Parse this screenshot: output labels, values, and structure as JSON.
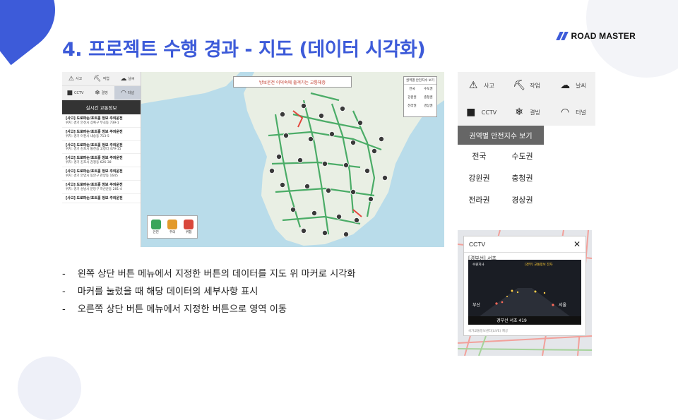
{
  "slide": {
    "title": "4. 프로젝트 수행 경과 - 지도 (데이터 시각화)",
    "logo_text": "ROAD MASTER",
    "bullets": [
      "왼쪽 상단 버튼 메뉴에서 지정한 버튼의 데이터를 지도 위 마커로 시각화",
      "마커를 눌렀을 때 해당 데이터의 세부사항 표시",
      "오른쪽 상단 버튼 메뉴에서 지정한 버튼으로 영역 이동"
    ],
    "bullet_mark": "-"
  },
  "screenshot": {
    "sidebar_buttons": [
      {
        "label": "사고",
        "icon": "accident-icon"
      },
      {
        "label": "작업",
        "icon": "roadwork-icon"
      },
      {
        "label": "날씨",
        "icon": "weather-icon"
      },
      {
        "label": "CCTV",
        "icon": "cctv-icon"
      },
      {
        "label": "결빙",
        "icon": "snowflake-icon"
      },
      {
        "label": "터널",
        "icon": "tunnel-icon"
      }
    ],
    "sidebar_header": "실시간 교통정보",
    "sidebar_items": [
      {
        "title": "[사고] 도로파손/포트홀 정보 주의운전",
        "detail": "위치: 경기 안산시 상록구 부곡동 739-1"
      },
      {
        "title": "[사고] 도로파손/포트홀 정보 주의운전",
        "detail": "위치: 경기 이천시 내승동 713-5"
      },
      {
        "title": "[사고] 도로파손/포트홀 정보 주의운전",
        "detail": "위치: 경기 김포시 통진읍 고정리 479-15"
      },
      {
        "title": "[사고] 도로파손/포트홀 정보 주의운전",
        "detail": "위치: 경기 김포시 감정동 626-38"
      },
      {
        "title": "[사고] 도로파손/포트홀 정보 주의운전",
        "detail": "위치: 경기 안양시 동안구 관양동 1645"
      },
      {
        "title": "[사고] 도로파손/포트홀 정보 주의운전",
        "detail": "위치: 경기 성남시 분당구 하산운동 281-4"
      },
      {
        "title": "[사고] 도로파손/포트홀 정보 주의운전",
        "detail": ""
      }
    ],
    "map_search_text": "방보운전 이덕속에 출격가는 교통체증",
    "region_panel": {
      "title": "권역별 안전지수 보기",
      "regions": [
        "전국",
        "수도권",
        "강원권",
        "충청권",
        "전라권",
        "경상권"
      ]
    },
    "legend": [
      {
        "label": "안전",
        "color": "#3aa55a"
      },
      {
        "label": "주의",
        "color": "#e39a2a"
      },
      {
        "label": "위험",
        "color": "#d9473b"
      }
    ]
  },
  "panel": {
    "categories": [
      {
        "label": "사고",
        "icon": "accident-icon"
      },
      {
        "label": "작업",
        "icon": "roadwork-icon"
      },
      {
        "label": "날씨",
        "icon": "weather-icon"
      },
      {
        "label": "CCTV",
        "icon": "cctv-icon"
      },
      {
        "label": "결빙",
        "icon": "snowflake-icon"
      },
      {
        "label": "터널",
        "icon": "tunnel-icon"
      }
    ],
    "region_title": "권역별 안전지수 보기",
    "regions": [
      "전국",
      "수도권",
      "강원권",
      "충청권",
      "전라권",
      "경상권"
    ]
  },
  "cctv": {
    "title": "CCTV",
    "subtitle": "[경부선] 서초",
    "video_text": {
      "top_label": "수원지사",
      "banner": "[경부] 교통정보 전자",
      "left": "부산",
      "right": "서울",
      "bottom": "경부선    서초    419"
    },
    "footer": "국가교통정보센터(LIVE) 제공"
  },
  "colors": {
    "accent": "#3d5bd9",
    "road_green": "#3aa55a",
    "road_red": "#e3453c",
    "land": "#e9efe4",
    "sea": "#b9dcea"
  }
}
